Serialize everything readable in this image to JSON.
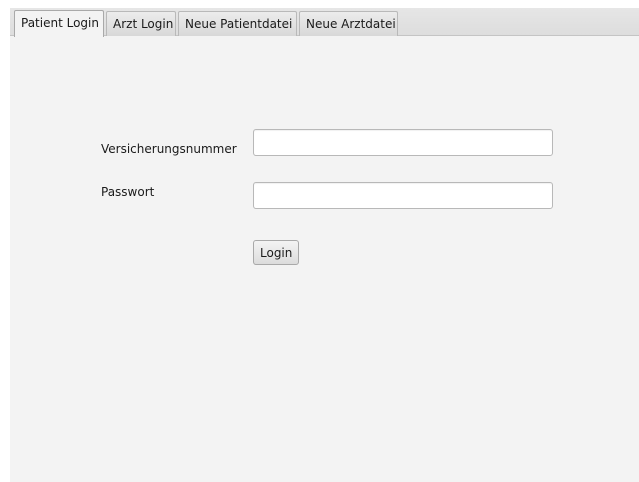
{
  "tabs": [
    {
      "label": "Patient Login",
      "active": true
    },
    {
      "label": "Arzt Login",
      "active": false
    },
    {
      "label": "Neue Patientdatei",
      "active": false
    },
    {
      "label": "Neue Arztdatei",
      "active": false
    }
  ],
  "form": {
    "insurance_label": "Versicherungsnummer",
    "insurance_value": "",
    "password_label": "Passwort",
    "password_value": "",
    "login_button": "Login"
  },
  "colors": {
    "panel_background": "#f3f3f3",
    "tab_bar_background": "#e2e2e2",
    "field_border": "#b8b8b8"
  }
}
